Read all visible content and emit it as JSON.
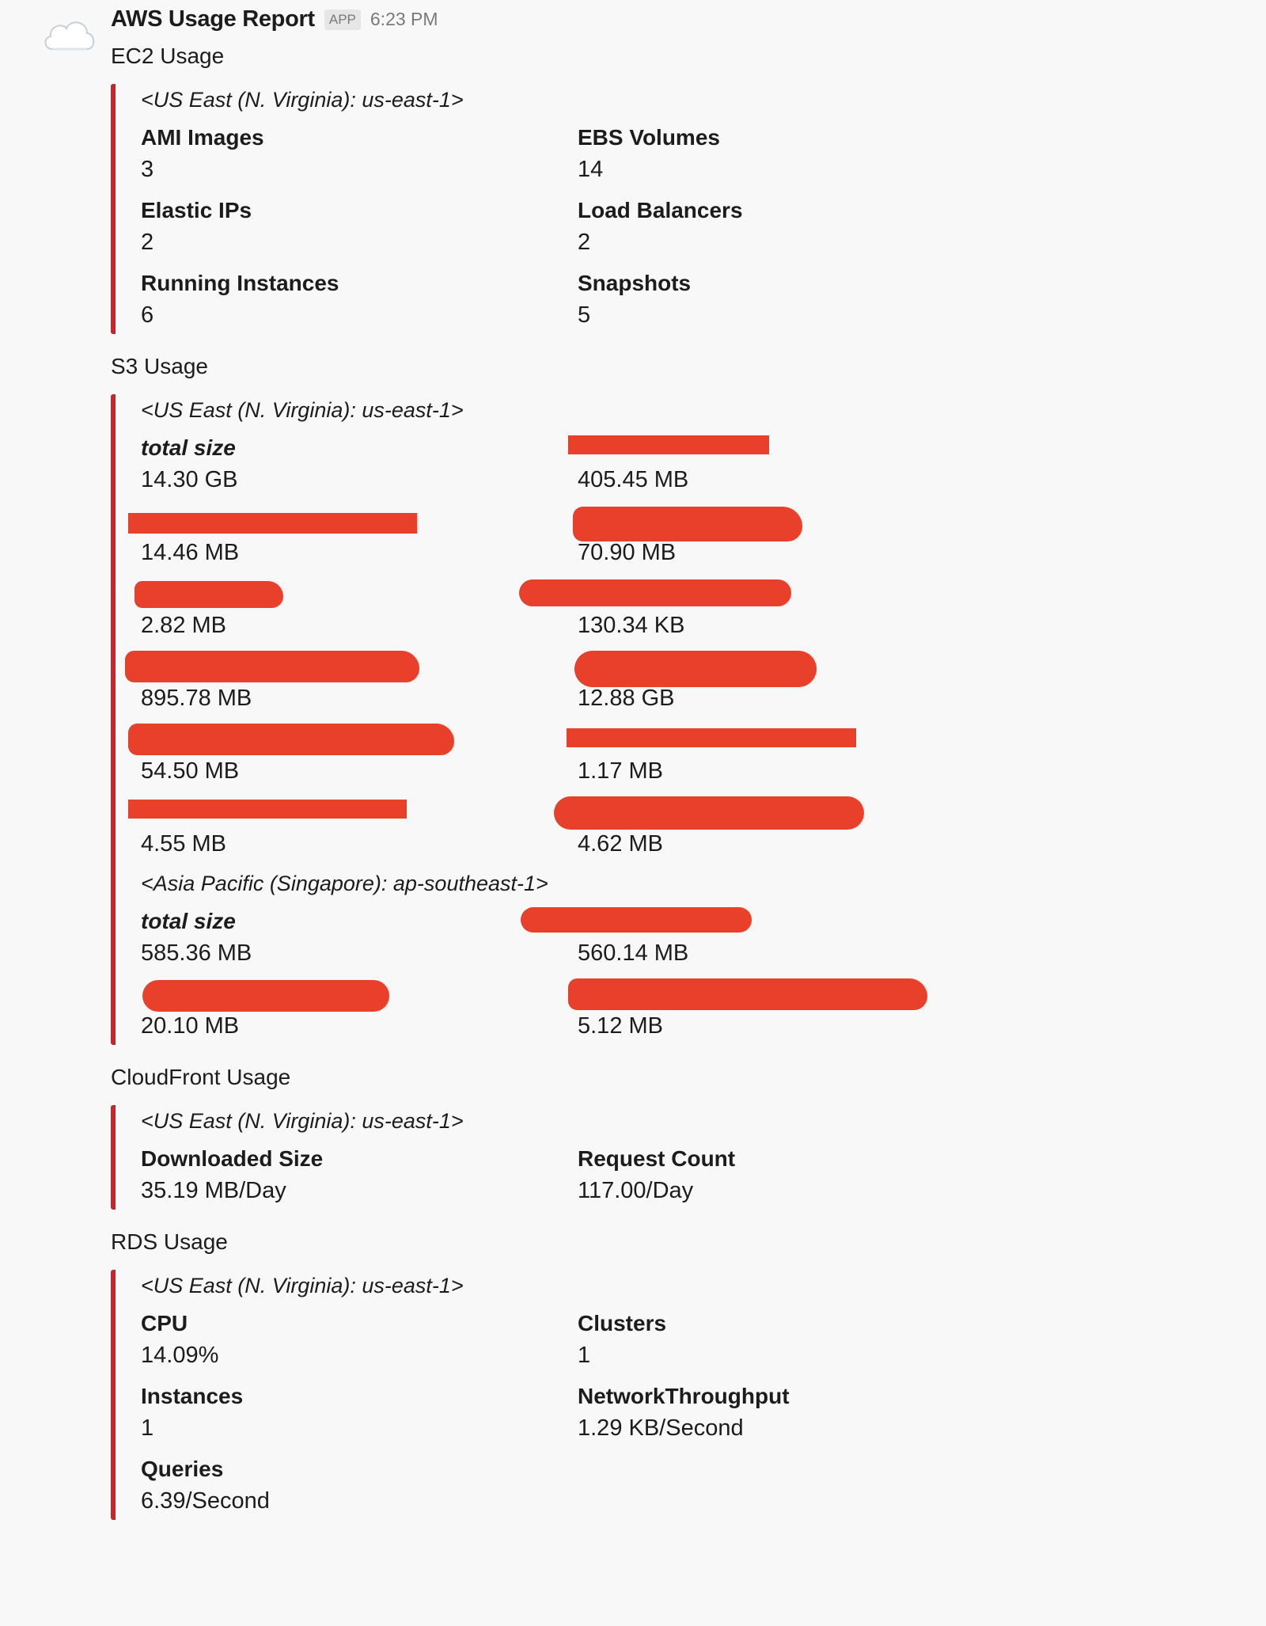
{
  "message": {
    "app_name": "AWS Usage Report",
    "app_badge": "APP",
    "time": "6:23 PM",
    "avatar_icon": "cloud-icon"
  },
  "sections": {
    "ec2": {
      "title": "EC2 Usage",
      "region": "<US East (N. Virginia): us-east-1>",
      "fields": [
        {
          "title": "AMI Images",
          "value": "3"
        },
        {
          "title": "EBS Volumes",
          "value": "14"
        },
        {
          "title": "Elastic IPs",
          "value": "2"
        },
        {
          "title": "Load Balancers",
          "value": "2"
        },
        {
          "title": "Running Instances",
          "value": "6"
        },
        {
          "title": "Snapshots",
          "value": "5"
        }
      ]
    },
    "s3": {
      "title": "S3 Usage",
      "region1": "<US East (N. Virginia): us-east-1>",
      "region1_fields": [
        {
          "title": "total size",
          "value": "14.30 GB"
        },
        {
          "title": "",
          "value": "405.45 MB"
        },
        {
          "title": "",
          "value": "14.46 MB"
        },
        {
          "title": "",
          "value": "70.90 MB"
        },
        {
          "title": "",
          "value": "2.82 MB"
        },
        {
          "title": "",
          "value": "130.34 KB"
        },
        {
          "title": "",
          "value": "895.78 MB"
        },
        {
          "title": "",
          "value": "12.88 GB"
        },
        {
          "title": "",
          "value": "54.50 MB"
        },
        {
          "title": "",
          "value": "1.17 MB"
        },
        {
          "title": "",
          "value": "4.55 MB"
        },
        {
          "title": "",
          "value": "4.62 MB"
        }
      ],
      "region2": "<Asia Pacific (Singapore): ap-southeast-1>",
      "region2_fields": [
        {
          "title": "total size",
          "value": "585.36 MB"
        },
        {
          "title": "",
          "value": "560.14 MB"
        },
        {
          "title": "",
          "value": "20.10 MB"
        },
        {
          "title": "",
          "value": "5.12 MB"
        }
      ]
    },
    "cloudfront": {
      "title": "CloudFront Usage",
      "region": "<US East (N. Virginia): us-east-1>",
      "fields": [
        {
          "title": "Downloaded Size",
          "value": "35.19 MB/Day"
        },
        {
          "title": "Request Count",
          "value": "117.00/Day"
        }
      ]
    },
    "rds": {
      "title": "RDS Usage",
      "region": "<US East (N. Virginia): us-east-1>",
      "fields": [
        {
          "title": "CPU",
          "value": "14.09%"
        },
        {
          "title": "Clusters",
          "value": "1"
        },
        {
          "title": "Instances",
          "value": "1"
        },
        {
          "title": "NetworkThroughput",
          "value": "1.29 KB/Second"
        },
        {
          "title": "Queries",
          "value": "6.39/Second"
        }
      ]
    }
  },
  "colors": {
    "attachment_bar": "#c1272d",
    "redaction": "#e8402a",
    "background": "#f8f8f8"
  }
}
